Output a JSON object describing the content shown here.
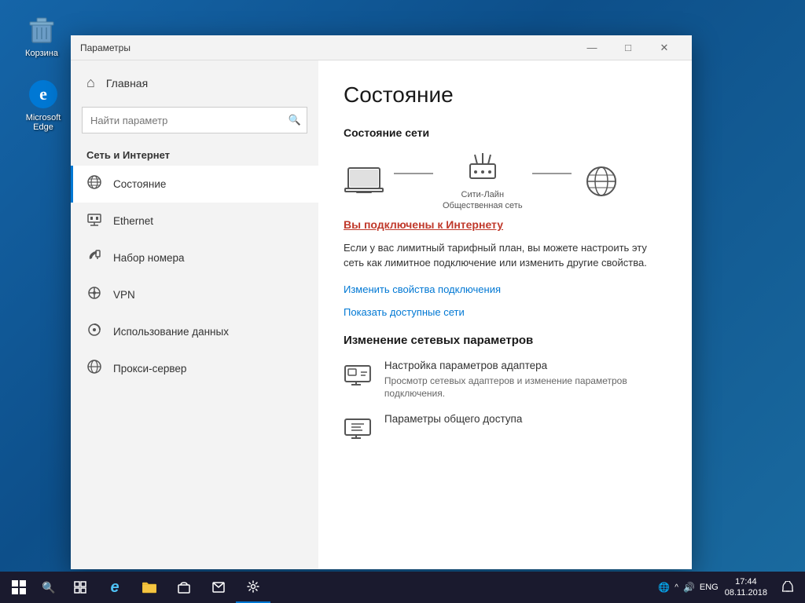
{
  "desktop": {
    "icons": [
      {
        "id": "recycle-bin",
        "label": "Корзина",
        "type": "trash"
      },
      {
        "id": "edge",
        "label": "Microsoft Edge",
        "type": "edge"
      }
    ]
  },
  "taskbar": {
    "start_label": "⊞",
    "time": "17:44",
    "date": "08.11.2018",
    "lang": "ENG",
    "items": [
      {
        "id": "search",
        "icon": "🔍"
      },
      {
        "id": "task-view",
        "icon": "❑"
      },
      {
        "id": "edge",
        "icon": "e"
      },
      {
        "id": "explorer",
        "icon": "📁"
      },
      {
        "id": "store",
        "icon": "🛍"
      },
      {
        "id": "mail",
        "icon": "✉"
      },
      {
        "id": "settings",
        "icon": "⚙"
      }
    ]
  },
  "window": {
    "title": "Параметры",
    "controls": {
      "minimize": "—",
      "maximize": "□",
      "close": "✕"
    }
  },
  "sidebar": {
    "home_label": "Главная",
    "search_placeholder": "Найти параметр",
    "section_title": "Сеть и Интернет",
    "nav_items": [
      {
        "id": "status",
        "label": "Состояние",
        "icon": "🌐",
        "active": true
      },
      {
        "id": "ethernet",
        "label": "Ethernet",
        "icon": "🖥"
      },
      {
        "id": "dialup",
        "label": "Набор номера",
        "icon": "📞"
      },
      {
        "id": "vpn",
        "label": "VPN",
        "icon": "🔗"
      },
      {
        "id": "data-usage",
        "label": "Использование данных",
        "icon": "📊"
      },
      {
        "id": "proxy",
        "label": "Прокси-сервер",
        "icon": "🌐"
      }
    ]
  },
  "main": {
    "page_title": "Состояние",
    "network_status_heading": "Состояние сети",
    "network_device_label": "Сити-Лайн\nОбщественная сеть",
    "connected_text": "Вы подключены к Интернету",
    "info_text": "Если у вас лимитный тарифный план, вы можете настроить эту сеть как лимитное подключение или изменить другие свойства.",
    "link_change_props": "Изменить свойства подключения",
    "link_show_networks": "Показать доступные сети",
    "change_settings_heading": "Изменение сетевых параметров",
    "cards": [
      {
        "id": "adapter-settings",
        "title": "Настройка параметров адаптера",
        "desc": "Просмотр сетевых адаптеров и изменение параметров подключения."
      },
      {
        "id": "sharing-settings",
        "title": "Параметры общего доступа",
        "desc": ""
      }
    ]
  }
}
